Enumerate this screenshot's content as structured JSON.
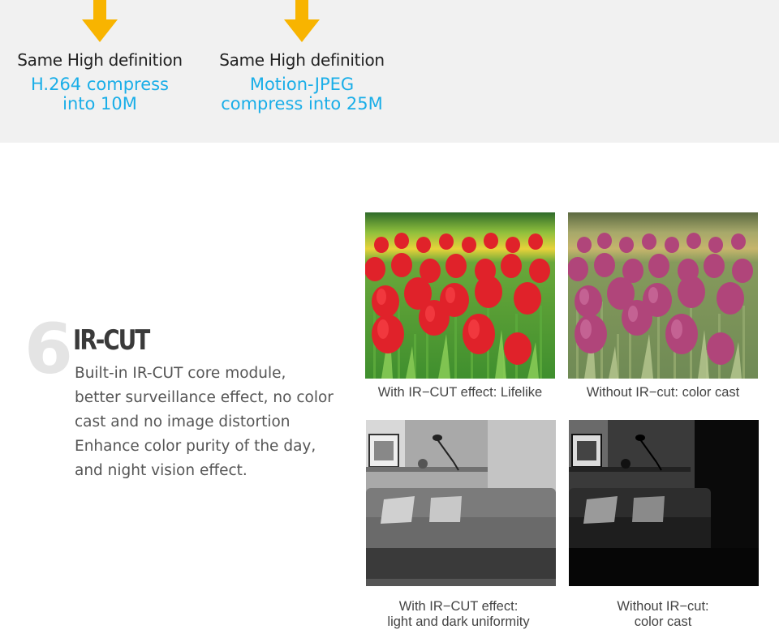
{
  "compare": [
    {
      "title": "Same High definition",
      "detail_line1": "H.264 compress",
      "detail_line2": "into 10M",
      "icon": "down-arrow-icon"
    },
    {
      "title": "Same High definition",
      "detail_line1": "Motion-JPEG",
      "detail_line2": "compress into 25M",
      "icon": "down-arrow-icon"
    }
  ],
  "feature": {
    "number": "6",
    "title": "IR-CUT",
    "description": "Built-in IR-CUT core module, better surveillance effect, no color cast and no image distortion Enhance color purity of the day, and night vision effect."
  },
  "photos": [
    {
      "caption_line1": "With IR−CUT effect: Lifelike",
      "caption_line2": ""
    },
    {
      "caption_line1": "Without IR−cut: color cast",
      "caption_line2": ""
    },
    {
      "caption_line1": "With IR−CUT effect:",
      "caption_line2": "light and dark uniformity"
    },
    {
      "caption_line1": "Without IR−cut:",
      "caption_line2": "color cast"
    }
  ],
  "colors": {
    "accent_blue": "#1aaee8",
    "arrow_orange": "#f8b400",
    "band_bg": "#f1f1f1"
  }
}
